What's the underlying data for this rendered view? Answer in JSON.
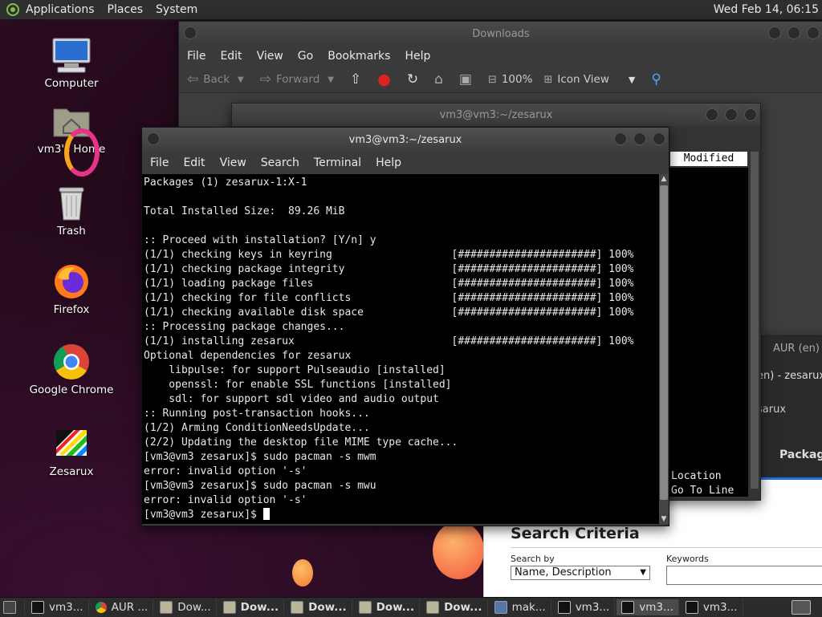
{
  "top_panel": {
    "applications": "Applications",
    "places": "Places",
    "system": "System",
    "clock": "Wed Feb 14, 06:15"
  },
  "desktop_icons": [
    {
      "label": "Computer",
      "icon": "computer-icon"
    },
    {
      "label": "vm3's Home",
      "icon": "home-folder-icon"
    },
    {
      "label": "Trash",
      "icon": "trash-icon"
    },
    {
      "label": "Firefox",
      "icon": "firefox-icon"
    },
    {
      "label": "Google Chrome",
      "icon": "chrome-icon"
    },
    {
      "label": "Zesarux",
      "icon": "zesarux-icon"
    }
  ],
  "file_manager": {
    "title": "Downloads",
    "menu": [
      "File",
      "Edit",
      "View",
      "Go",
      "Bookmarks",
      "Help"
    ],
    "toolbar": {
      "back": "Back",
      "forward": "Forward",
      "zoom": "100%",
      "view_mode": "Icon View"
    }
  },
  "back_terminal": {
    "title": "vm3@vm3:~/zesarux",
    "column_header": "Modified",
    "lines": [
      "Location",
      "Go To Line"
    ]
  },
  "aur_window": {
    "title": "AUR (en) -",
    "line2": "en) - zesarux",
    "line3": "sarux",
    "packages": "Package"
  },
  "browser": {
    "search_criteria": "Search Criteria",
    "search_by_label": "Search by",
    "search_by_value": "Name, Description",
    "keywords_label": "Keywords"
  },
  "terminal": {
    "title": "vm3@vm3:~/zesarux",
    "menu": [
      "File",
      "Edit",
      "View",
      "Search",
      "Terminal",
      "Help"
    ],
    "lines": [
      "Packages (1) zesarux-1:X-1",
      "",
      "Total Installed Size:  89.26 MiB",
      "",
      ":: Proceed with installation? [Y/n] y",
      "(1/1) checking keys in keyring                   [######################] 100%",
      "(1/1) checking package integrity                 [######################] 100%",
      "(1/1) loading package files                      [######################] 100%",
      "(1/1) checking for file conflicts                [######################] 100%",
      "(1/1) checking available disk space              [######################] 100%",
      ":: Processing package changes...",
      "(1/1) installing zesarux                         [######################] 100%",
      "Optional dependencies for zesarux",
      "    libpulse: for support Pulseaudio [installed]",
      "    openssl: for enable SSL functions [installed]",
      "    sdl: for support sdl video and audio output",
      ":: Running post-transaction hooks...",
      "(1/2) Arming ConditionNeedsUpdate...",
      "(2/2) Updating the desktop file MIME type cache...",
      "[vm3@vm3 zesarux]$ sudo pacman -s mwm",
      "error: invalid option '-s'",
      "[vm3@vm3 zesarux]$ sudo pacman -s mwu",
      "error: invalid option '-s'"
    ],
    "prompt": "[vm3@vm3 zesarux]$ "
  },
  "taskbar": [
    {
      "label": "vm3...",
      "icon": "terminal-icon",
      "bold": false,
      "active": false
    },
    {
      "label": "AUR ...",
      "icon": "chrome-icon",
      "bold": false,
      "active": false
    },
    {
      "label": "Dow...",
      "icon": "folder-icon",
      "bold": false,
      "active": false
    },
    {
      "label": "Dow...",
      "icon": "folder-icon",
      "bold": true,
      "active": false
    },
    {
      "label": "Dow...",
      "icon": "folder-icon",
      "bold": true,
      "active": false
    },
    {
      "label": "Dow...",
      "icon": "folder-icon",
      "bold": true,
      "active": false
    },
    {
      "label": "Dow...",
      "icon": "folder-icon",
      "bold": true,
      "active": false
    },
    {
      "label": "mak...",
      "icon": "app-icon",
      "bold": false,
      "active": false
    },
    {
      "label": "vm3...",
      "icon": "terminal-icon",
      "bold": false,
      "active": false
    },
    {
      "label": "vm3...",
      "icon": "terminal-icon",
      "bold": false,
      "active": true
    },
    {
      "label": "vm3...",
      "icon": "terminal-icon",
      "bold": false,
      "active": false
    }
  ]
}
